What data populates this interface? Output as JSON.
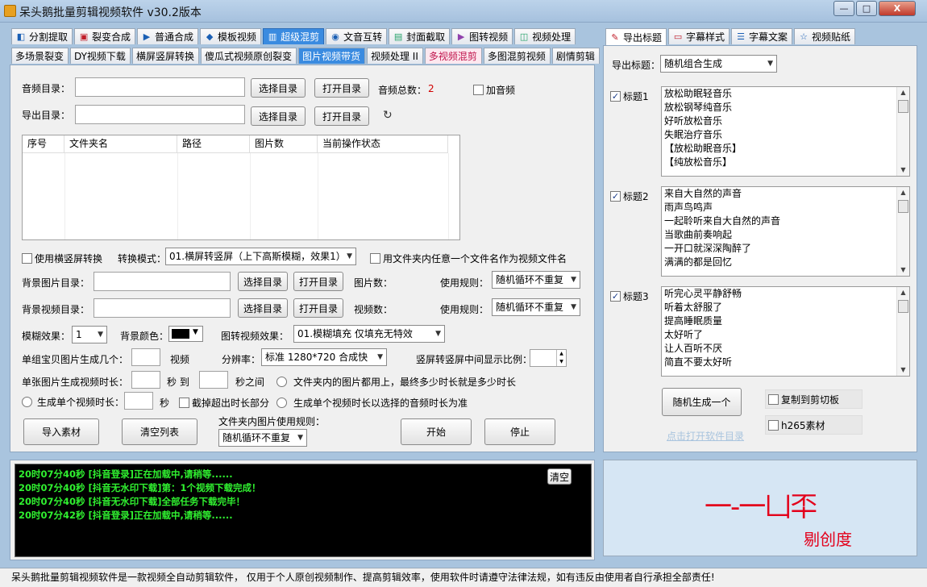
{
  "window": {
    "title": "呆头鹅批量剪辑视频软件    v30.2版本",
    "min": "—",
    "max": "□",
    "close": "X"
  },
  "main_tabs": [
    {
      "label": "分割提取",
      "icon": "scissors-icon",
      "glyph": "◧",
      "color": "#1a5fb4"
    },
    {
      "label": "裂变合成",
      "icon": "split-icon",
      "glyph": "▣",
      "color": "#c01c28"
    },
    {
      "label": "普通合成",
      "icon": "play-icon",
      "glyph": "▶",
      "color": "#1a5fb4"
    },
    {
      "label": "模板视频",
      "icon": "template-icon",
      "glyph": "◆",
      "color": "#1a5fb4"
    },
    {
      "label": "超级混剪",
      "icon": "equalizer-icon",
      "glyph": "▥",
      "color": "#ffffff"
    },
    {
      "label": "文音互转",
      "icon": "microphone-icon",
      "glyph": "◉",
      "color": "#1a5fb4"
    },
    {
      "label": "封面截取",
      "icon": "image-icon",
      "glyph": "▤",
      "color": "#26a269"
    },
    {
      "label": "图转视频",
      "icon": "film-icon",
      "glyph": "▶",
      "color": "#9141ac"
    },
    {
      "label": "视频处理",
      "icon": "video-process-icon",
      "glyph": "◫",
      "color": "#26a269"
    }
  ],
  "sub_tabs": [
    "多场景裂变",
    "DY视频下载",
    "横屏竖屏转换",
    "傻瓜式视频原创裂变",
    "图片视频带货",
    "视频处理 II",
    "多视频混剪",
    "多图混剪视频",
    "剧情剪辑"
  ],
  "form": {
    "audio_dir_label": "音频目录：",
    "export_dir_label": "导出目录：",
    "select_dir": "选择目录",
    "open_dir": "打开目录",
    "audio_total_label": "音频总数：",
    "audio_total_value": "2",
    "add_audio_label": "加音频",
    "table_headers": [
      "序号",
      "文件夹名",
      "路径",
      "图片数",
      "当前操作状态"
    ],
    "use_hv_label": "使用横竖屏转换",
    "convert_mode_label": "转换模式：",
    "convert_mode_value": "01.横屏转竖屏（上下高斯模糊，效果1）",
    "use_filename_label": "用文件夹内任意一个文件名作为视频文件名",
    "bg_image_dir_label": "背景图片目录：",
    "image_count_label": "图片数：",
    "use_rule_label": "使用规则：",
    "rule_value": "随机循环不重复",
    "bg_video_dir_label": "背景视频目录：",
    "video_count_label": "视频数：",
    "blur_label": "模糊效果：",
    "blur_value": "1",
    "bg_color_label": "背景颜色：",
    "img2video_effect_label": "图转视频效果：",
    "img2video_effect_value": "01.模糊填充 仅填充无特效",
    "group_count_label": "单组宝贝图片生成几个：",
    "video_unit": "视频",
    "resolution_label": "分辨率：",
    "resolution_value": "标准 1280*720 合成快",
    "vertical_ratio_label": "竖屏转竖屏中间显示比例：",
    "single_dur_label": "单张图片生成视频时长：",
    "sec_to": "秒 到",
    "sec_between": "秒之间",
    "folder_all_label": "文件夹内的图片都用上，最终多少时长就是多少时长",
    "single_video_label": "生成单个视频时长：",
    "sec": "秒",
    "trim_label": "截掉超出时长部分",
    "by_audio_label": "生成单个视频时长以选择的音频时长为准",
    "import_btn": "导入素材",
    "clear_list_btn": "清空列表",
    "folder_rule_label": "文件夹内图片使用规则：",
    "start_btn": "开始",
    "stop_btn": "停止"
  },
  "log": {
    "clear_btn": "清空",
    "lines": [
      "20时07分40秒 [抖音登录]正在加载中,请稍等......",
      "20时07分40秒 [抖音无水印下载]第：1个视频下载完成！",
      "20时07分40秒 [抖音无水印下载]全部任务下载完毕！",
      "20时07分42秒 [抖音登录]正在加载中,请稍等......"
    ]
  },
  "right_tabs": [
    {
      "label": "导出标题",
      "icon": "export-title-icon",
      "glyph": "✎",
      "color": "#c01c28"
    },
    {
      "label": "字幕样式",
      "icon": "subtitle-style-icon",
      "glyph": "▭",
      "color": "#c01c28"
    },
    {
      "label": "字幕文案",
      "icon": "subtitle-text-icon",
      "glyph": "☰",
      "color": "#1a5fb4"
    },
    {
      "label": "视频贴纸",
      "icon": "sticker-icon",
      "glyph": "☆",
      "color": "#1a5fb4"
    }
  ],
  "right": {
    "export_title_label": "导出标题：",
    "export_title_value": "随机组合生成",
    "titles": [
      {
        "label": "标题1",
        "lines": [
          "放松助眠轻音乐",
          "放松钢琴纯音乐",
          "好听放松音乐",
          "失眠治疗音乐",
          "【放松助眠音乐】",
          "【纯放松音乐】"
        ]
      },
      {
        "label": "标题2",
        "lines": [
          "来自大自然的声音",
          "雨声鸟鸣声",
          "一起聆听来自大自然的声音",
          "当歌曲前奏响起",
          "一开口就深深陶醉了",
          "满满的都是回忆"
        ]
      },
      {
        "label": "标题3",
        "lines": [
          "听完心灵平静舒畅",
          "听着太舒服了",
          "提高睡眠质量",
          "太好听了",
          "让人百听不厌",
          "简直不要太好听"
        ]
      }
    ],
    "random_btn": "随机生成一个",
    "copy_label": "复制到剪切板",
    "h265_label": "h265素材",
    "open_dir_link": "点击打开软件目录"
  },
  "promo": {
    "line1": "一-一凵㔻",
    "line2": "剔创度"
  },
  "status": "呆头鹅批量剪辑视频软件是一款视频全自动剪辑软件， 仅用于个人原创视频制作、提高剪辑效率，使用软件时请遵守法律法规，如有违反由使用者自行承担全部责任!"
}
